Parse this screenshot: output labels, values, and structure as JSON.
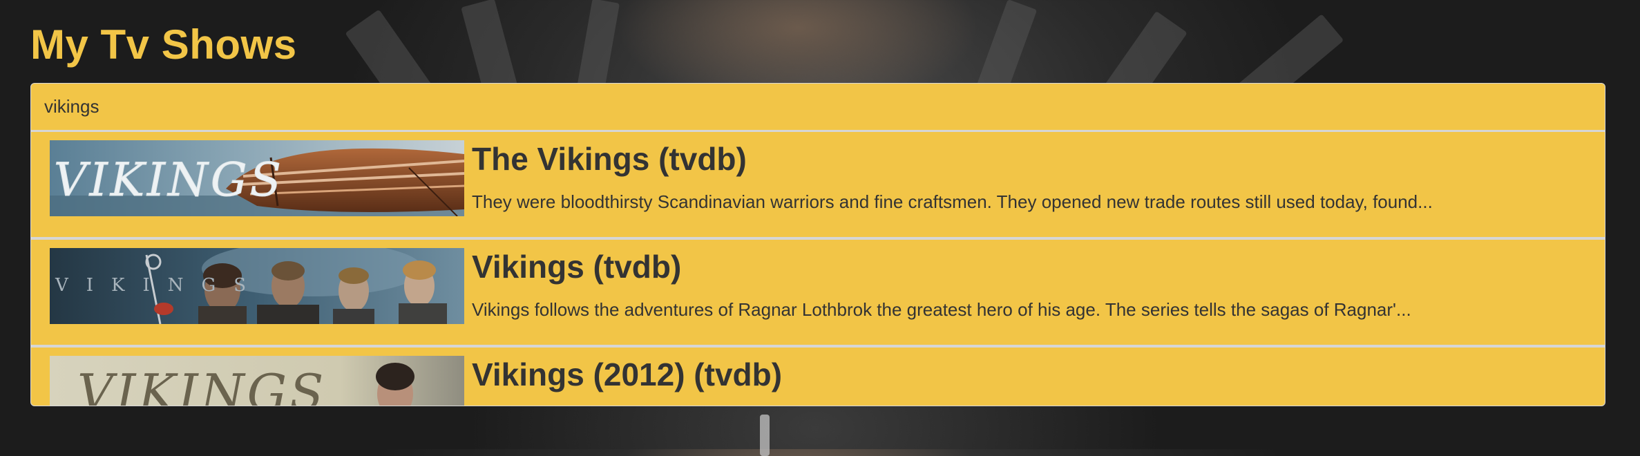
{
  "app": {
    "title": "My Tv Shows"
  },
  "search": {
    "value": "vikings"
  },
  "results": [
    {
      "title": "The Vikings (tvdb)",
      "description": "They were bloodthirsty Scandinavian warriors and fine craftsmen. They opened new trade routes still used today, found...",
      "banner_text": "VIKINGS"
    },
    {
      "title": "Vikings (tvdb)",
      "description": "Vikings follows the adventures of Ragnar Lothbrok the greatest hero of his age. The series tells the sagas of Ragnar'...",
      "banner_text": "VIKINGS"
    },
    {
      "title": "Vikings (2012) (tvdb)",
      "description": "",
      "banner_text": "VIKINGS"
    }
  ],
  "colors": {
    "accent": "#f2c547",
    "text": "#333333",
    "divider": "#d6d6d6"
  }
}
